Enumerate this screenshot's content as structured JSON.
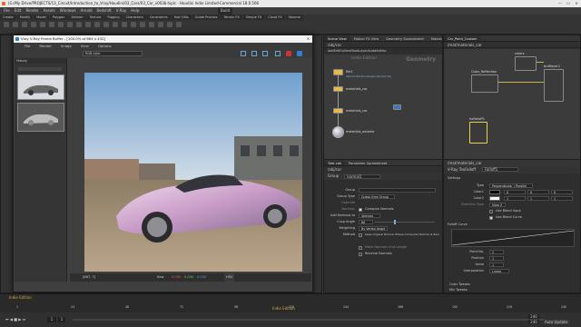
{
  "window": {
    "title": "(G:/My Drive/PROJECTS/13_Circuit/Introduction_to_Vray/Houdini/03_Cars/03_Car_v003b.hiplc - Houdini Indie Limited-Commercial 18.0.566",
    "minimize": "—",
    "maximize": "☐",
    "close": "✕"
  },
  "menubar": [
    "File",
    "Edit",
    "Render",
    "Assets",
    "Windows",
    "Arnold",
    "Redshift",
    "V-Ray",
    "Help"
  ],
  "desktop_dropdown": "Build",
  "shelf_tabs": [
    "Create",
    "Modify",
    "Model",
    "Polygon",
    "Deform",
    "Texture",
    "Rigging",
    "Characters",
    "Constraints",
    "Hair Utils",
    "Guide Process",
    "Terrain FX",
    "Simple FX",
    "Cloud FX",
    "Volume"
  ],
  "left_strip": {
    "label": "History"
  },
  "vray": {
    "title": "Vray V-Ray Frame Buffer - [100.0% of 864 x 432]",
    "menus": [
      "File",
      "Render",
      "Image",
      "View",
      "Options"
    ],
    "channel": "RGB color",
    "history_label": "Compare 2 VFB",
    "status_coord": "[867, 7]",
    "status_mode": "Raw",
    "status_values": [
      "0.000",
      "0.000",
      "0.000"
    ],
    "status_space": "HSV"
  },
  "node_editor": {
    "path": "/obj/car",
    "tabs": [
      "Scene View",
      "Motion FX View",
      "Geometry Spreadsheet",
      "Material Palette",
      "Asset Browser"
    ],
    "mode_label": "Indie Edition",
    "context_label": "Geometry",
    "menus": [
      "Add",
      "Edit",
      "Go",
      "View",
      "Tools",
      "Layout",
      "Labels",
      "Help"
    ],
    "nodes": [
      {
        "label": "file1",
        "sublabel": "cabin/collection/design/car/car7.obj"
      },
      {
        "label": "materials_car",
        "sublabel": ""
      },
      {
        "label": "materials_car",
        "sublabel": ""
      },
      {
        "label": "materials_exterior",
        "sublabel": ""
      }
    ]
  },
  "vop_editor": {
    "path": "/mat/materials_car",
    "tabs": [
      "Car_Paint_Custom"
    ],
    "nodes": [
      "colors",
      "Color_Reflection",
      "brdflayer1",
      "hoFalloff1"
    ]
  },
  "param_group": {
    "path": "/obj/car",
    "tabs": [
      "Tree List",
      "Parameter Spreadsheet"
    ],
    "node_type": "Group",
    "node_name": "normal1",
    "rows": [
      {
        "label": "Group",
        "value": ""
      },
      {
        "label": "Group Type",
        "value": "Guess from Group"
      },
      {
        "label": "Override Normals",
        "value": ""
      },
      {
        "label": "Add Normals to",
        "value": "Vertices"
      },
      {
        "label": "Cusp Angle",
        "value": "60"
      },
      {
        "label": "Weighting Method",
        "value": "By Vertex Angle"
      }
    ],
    "checks": [
      "Compute Normals",
      "Keep Original Normal Where Computed Normal Is Zero",
      "Make Normals Unit Length",
      "Reverse Normals"
    ]
  },
  "param_vray": {
    "path": "/mat/materials_car",
    "node_type": "V-Ray TexFalloff",
    "node_name": "Falloff1",
    "section": "Settings",
    "rows": [
      {
        "label": "Type",
        "value": "Perpendicular / Parallel"
      },
      {
        "label": "Color1",
        "value": ""
      },
      {
        "label": "Color2",
        "value": ""
      },
      {
        "label": "Direction Type",
        "value": "View Z"
      },
      {
        "label": "Use Blend Input",
        "value": ""
      },
      {
        "label": "Use Blend Curve",
        "value": ""
      }
    ],
    "curve_section": "Falloff Curve",
    "curve_rows": [
      {
        "label": "Point No.",
        "value": "2"
      },
      {
        "label": "Position",
        "value": "1"
      },
      {
        "label": "Value",
        "value": "1"
      },
      {
        "label": "Interpolation",
        "value": "Linear"
      }
    ],
    "foldouts": [
      "Color Tweaks",
      "Mix Tweaks"
    ]
  },
  "timeline": {
    "frame": "1",
    "start": "1",
    "end": "240",
    "ruler_end": "240",
    "watermark": "Indie Edition",
    "auto_update": "Auto Update",
    "ticks": [
      "1",
      "24",
      "48",
      "72",
      "96",
      "120",
      "144",
      "168",
      "192",
      "216",
      "240"
    ]
  },
  "colors": {
    "sky": "#b8cfe0",
    "ground": "#9c8a73",
    "car": "#d9c0d8"
  }
}
